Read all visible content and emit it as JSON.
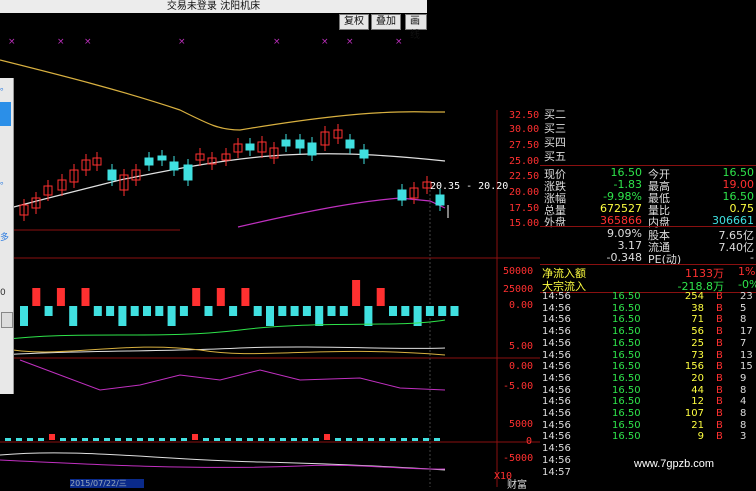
{
  "titlebar": {
    "title": "交易未登录  沈阳机床"
  },
  "toolbar": {
    "buttons": [
      "复权",
      "叠加",
      "画线"
    ]
  },
  "price_axis": [
    "32.50",
    "30.00",
    "27.50",
    "25.00",
    "22.50",
    "20.00",
    "17.50",
    "15.00"
  ],
  "price_annotation": "20.35 - 20.20",
  "volume_axis": [
    "50000",
    "25000",
    "0.00"
  ],
  "macd_axis": [
    "5.00",
    "0.00",
    "-5.00"
  ],
  "bottom_axis": [
    "5000",
    "0",
    "-5000"
  ],
  "bottom_scale": "X10",
  "left_labels": [
    "。",
    "。",
    "多",
    "0"
  ],
  "date_label": "2015/07/22/三",
  "watermark": "www.7gpzb.com",
  "bottom_right_label": "财富",
  "orderbook": [
    {
      "label": "买二"
    },
    {
      "label": "买三"
    },
    {
      "label": "买四"
    },
    {
      "label": "买五"
    }
  ],
  "quote": [
    {
      "l1": "现价",
      "v1": "16.50",
      "l2": "今开",
      "v2": "16.50"
    },
    {
      "l1": "涨跌",
      "v1": "-1.83",
      "l2": "最高",
      "v2": "19.00"
    },
    {
      "l1": "涨幅",
      "v1": "-9.98%",
      "l2": "最低",
      "v2": "16.50"
    },
    {
      "l1": "总量",
      "v1": "672527",
      "l2": "量比",
      "v2": "0.75"
    },
    {
      "l1": "外盘",
      "v1": "365866",
      "l2": "内盘",
      "v2": "306661"
    }
  ],
  "fundamentals": [
    {
      "v1": "9.09%",
      "l2": "股本",
      "v2": "7.65亿"
    },
    {
      "v1": "3.17",
      "l2": "流通",
      "v2": "7.40亿"
    },
    {
      "v1": "-0.348",
      "l2": "PE(动)",
      "v2": "-"
    }
  ],
  "flow": [
    {
      "label": "净流入额",
      "value": "1133万",
      "pct": "1%"
    },
    {
      "label": "大宗流入",
      "value": "-218.8万",
      "pct": "-0%"
    }
  ],
  "ticks": [
    {
      "time": "14:56",
      "price": "16.50",
      "vol": "254",
      "side": "B",
      "n": "23"
    },
    {
      "time": "14:56",
      "price": "16.50",
      "vol": "38",
      "side": "B",
      "n": "5"
    },
    {
      "time": "14:56",
      "price": "16.50",
      "vol": "71",
      "side": "B",
      "n": "8"
    },
    {
      "time": "14:56",
      "price": "16.50",
      "vol": "56",
      "side": "B",
      "n": "17"
    },
    {
      "time": "14:56",
      "price": "16.50",
      "vol": "25",
      "side": "B",
      "n": "7"
    },
    {
      "time": "14:56",
      "price": "16.50",
      "vol": "73",
      "side": "B",
      "n": "13"
    },
    {
      "time": "14:56",
      "price": "16.50",
      "vol": "156",
      "side": "B",
      "n": "15"
    },
    {
      "time": "14:56",
      "price": "16.50",
      "vol": "20",
      "side": "B",
      "n": "9"
    },
    {
      "time": "14:56",
      "price": "16.50",
      "vol": "44",
      "side": "B",
      "n": "8"
    },
    {
      "time": "14:56",
      "price": "16.50",
      "vol": "12",
      "side": "B",
      "n": "4"
    },
    {
      "time": "14:56",
      "price": "16.50",
      "vol": "107",
      "side": "B",
      "n": "8"
    },
    {
      "time": "14:56",
      "price": "16.50",
      "vol": "21",
      "side": "B",
      "n": "8"
    },
    {
      "time": "14:56",
      "price": "16.50",
      "vol": "9",
      "side": "B",
      "n": "3"
    },
    {
      "time": "14:56",
      "price": "",
      "vol": "",
      "side": "",
      "n": ""
    },
    {
      "time": "14:56",
      "price": "",
      "vol": "",
      "side": "",
      "n": ""
    },
    {
      "time": "14:57",
      "price": "",
      "vol": "",
      "side": "",
      "n": ""
    }
  ],
  "colors": {
    "up": "#ff3030",
    "down": "#40e0e0",
    "ma_yellow": "#d8b040",
    "ma_white": "#e0e0e0",
    "ma_purple": "#c030c0",
    "green": "#2ee34a"
  }
}
